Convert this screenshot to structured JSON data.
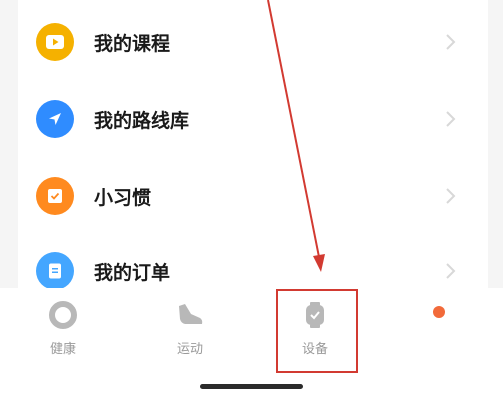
{
  "menu": {
    "items": [
      {
        "label": "我的课程",
        "icon": "play-icon",
        "color": "#f5b100"
      },
      {
        "label": "我的路线库",
        "icon": "navigation-arrow-icon",
        "color": "#2f8cff"
      },
      {
        "label": "小习惯",
        "icon": "habit-check-icon",
        "color": "#ff8a1f"
      },
      {
        "label": "我的订单",
        "icon": "order-document-icon",
        "color": "#44a6ff"
      }
    ]
  },
  "tabbar": {
    "tabs": [
      {
        "label": "健康",
        "icon": "health-ring-icon"
      },
      {
        "label": "运动",
        "icon": "sneaker-icon"
      },
      {
        "label": "设备",
        "icon": "watch-icon"
      }
    ],
    "profile_dot_color": "#f26a3a"
  },
  "annotation": {
    "color": "#d23a31"
  }
}
